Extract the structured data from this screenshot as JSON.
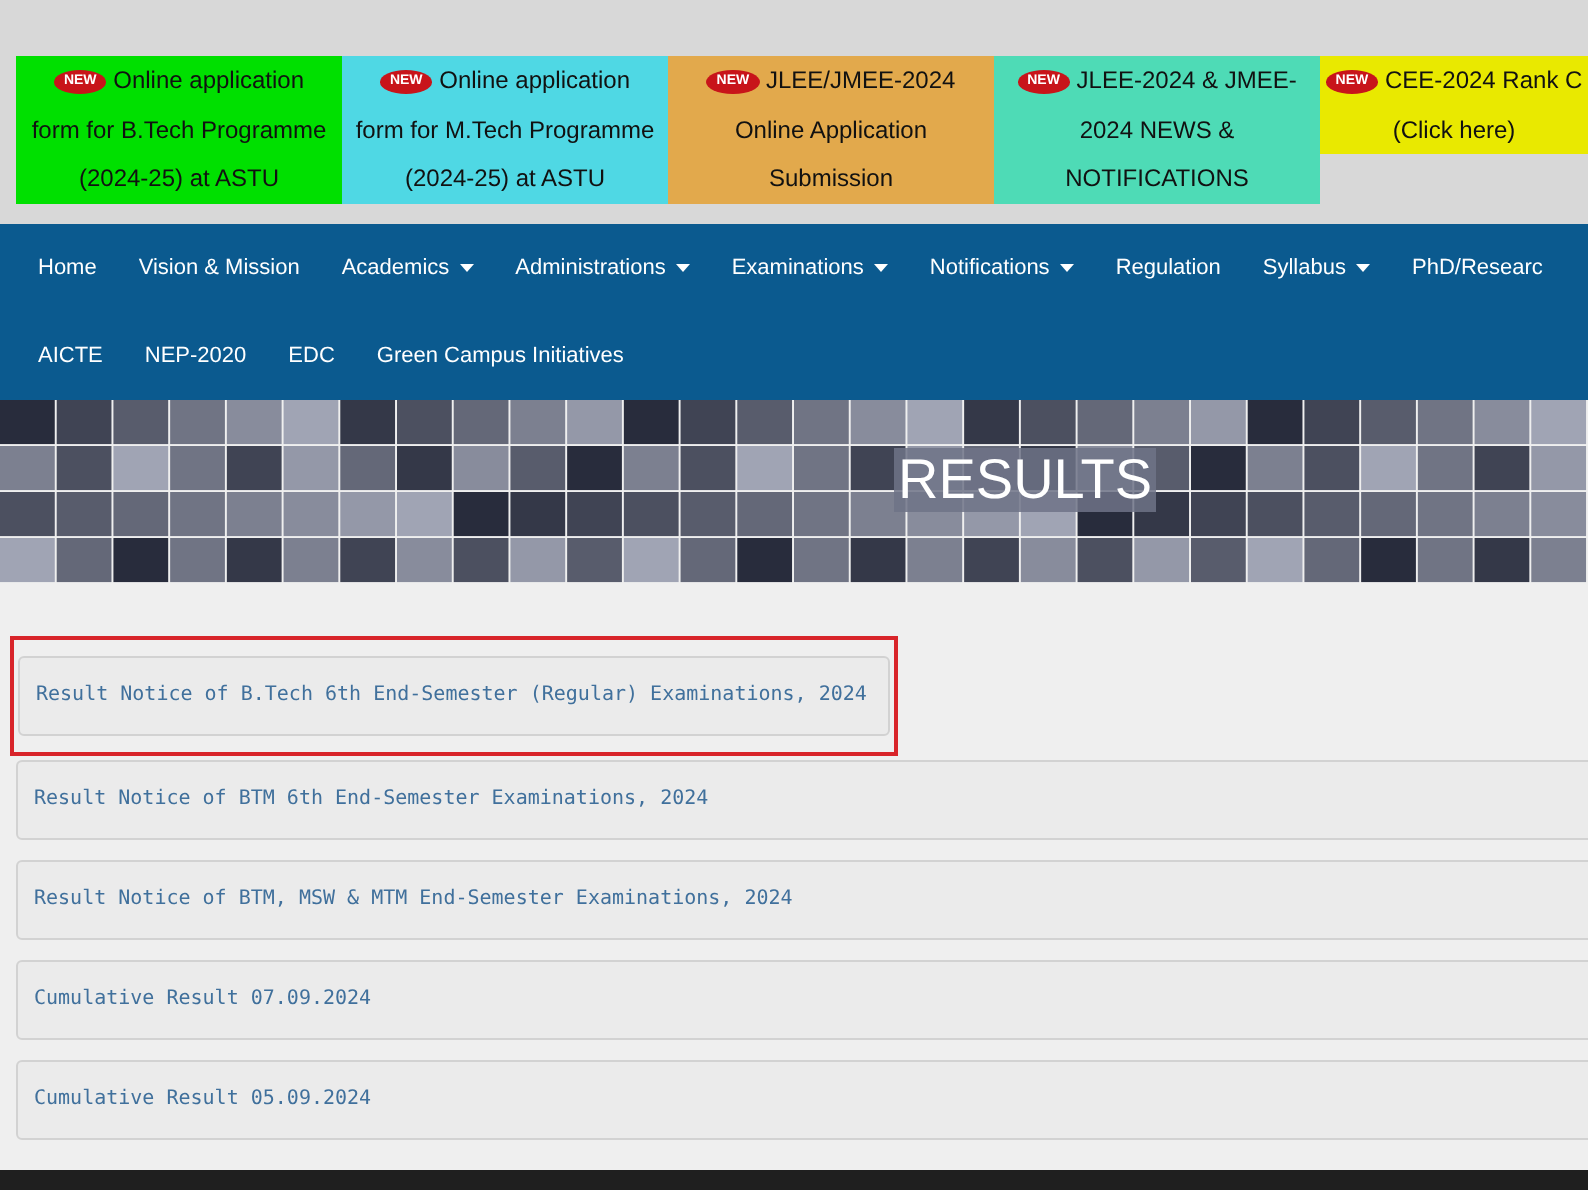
{
  "notices": [
    {
      "badge": "NEW",
      "text": "Online application form for B.Tech Programme (2024-25) at ASTU",
      "color": "#00e000"
    },
    {
      "badge": "NEW",
      "text": "Online application form for M.Tech Programme (2024-25) at ASTU",
      "color": "#4fd8e4"
    },
    {
      "badge": "NEW",
      "text": "JLEE/JMEE-2024 Online Application Submission",
      "color": "#e2a94c"
    },
    {
      "badge": "NEW",
      "text": "JLEE-2024 & JMEE-2024 NEWS & NOTIFICATIONS",
      "color": "#4edbb6"
    },
    {
      "badge": "NEW",
      "text": "CEE-2024 Rank C (Click here)",
      "color": "#e9e900"
    }
  ],
  "nav": {
    "row_1": [
      {
        "label": "Home",
        "dropdown": false
      },
      {
        "label": "Vision & Mission",
        "dropdown": false
      },
      {
        "label": "Academics",
        "dropdown": true
      },
      {
        "label": "Administrations",
        "dropdown": true
      },
      {
        "label": "Examinations",
        "dropdown": true
      },
      {
        "label": "Notifications",
        "dropdown": true
      },
      {
        "label": "Regulation",
        "dropdown": false
      },
      {
        "label": "Syllabus",
        "dropdown": true
      },
      {
        "label": "PhD/Researc",
        "dropdown": false
      }
    ],
    "row_2": [
      {
        "label": "AICTE",
        "dropdown": false
      },
      {
        "label": "NEP-2020",
        "dropdown": false
      },
      {
        "label": "EDC",
        "dropdown": false
      },
      {
        "label": "Green Campus Initiatives",
        "dropdown": false
      }
    ]
  },
  "banner": {
    "title": "RESULTS"
  },
  "results": [
    {
      "text": "Result Notice of B.Tech 6th End-Semester (Regular) Examinations, 2024",
      "highlighted": true
    },
    {
      "text": "Result Notice of BTM 6th End-Semester Examinations, 2024",
      "highlighted": false
    },
    {
      "text": "Result Notice of BTM, MSW & MTM End-Semester Examinations, 2024",
      "highlighted": false
    },
    {
      "text": "Cumulative Result 07.09.2024",
      "highlighted": false
    },
    {
      "text": "Cumulative Result 05.09.2024",
      "highlighted": false
    }
  ]
}
